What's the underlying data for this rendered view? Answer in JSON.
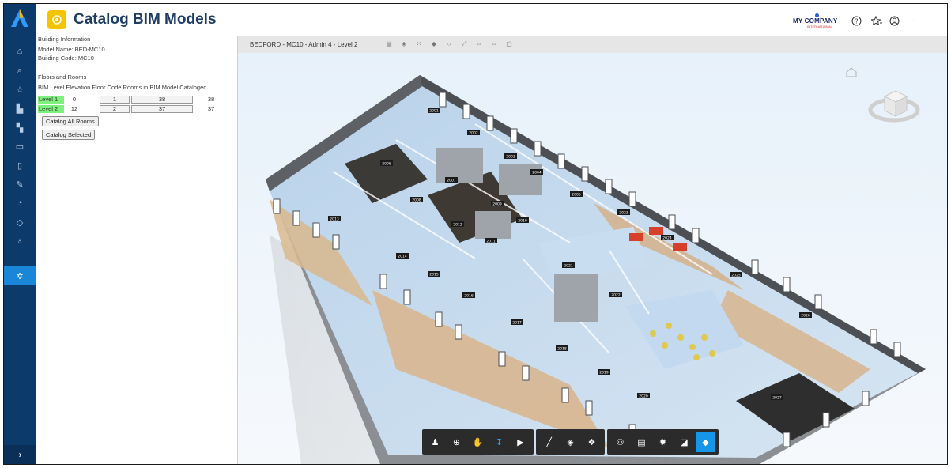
{
  "app": {
    "title": "Catalog BIM Models"
  },
  "header": {
    "company_name": "MY COMPANY",
    "company_sub": "INTERNATIONAL"
  },
  "building_info": {
    "heading": "Building Information",
    "model_name": "Model Name:  BED-MC10",
    "building_code": "Building Code: MC10"
  },
  "floors": {
    "heading": "Floors and Rooms",
    "columns_text": "BIM Level Elevation Floor Code Rooms in BIM Model Cataloged",
    "rows": [
      {
        "level": "Level 1",
        "elevation": "0",
        "floor_code": "1",
        "rooms": "38",
        "cataloged": "38"
      },
      {
        "level": "Level 2",
        "elevation": "12",
        "floor_code": "2",
        "rooms": "37",
        "cataloged": "37"
      }
    ]
  },
  "buttons": {
    "catalog_all": "Catalog All Rooms",
    "catalog_selected": "Catalog Selected"
  },
  "viewer": {
    "title": "BEDFORD - MC10 - Admin 4 - Level 2",
    "room_tags": [
      "2001",
      "2002",
      "2003",
      "2004",
      "2005",
      "2006",
      "2007",
      "2008",
      "2009",
      "2010",
      "2011",
      "2012",
      "2013",
      "2014",
      "2015",
      "2016",
      "2017",
      "2018",
      "2019",
      "2020",
      "2021",
      "2022",
      "2023",
      "2024",
      "2025",
      "2026",
      "2027"
    ]
  },
  "colors": {
    "rail": "#0c3a6b",
    "rail_active": "#1a86d8",
    "app_icon": "#f5c400",
    "title": "#1d3d66",
    "level_highlight": "#7cf27c",
    "tool_active": "#1596e8"
  }
}
